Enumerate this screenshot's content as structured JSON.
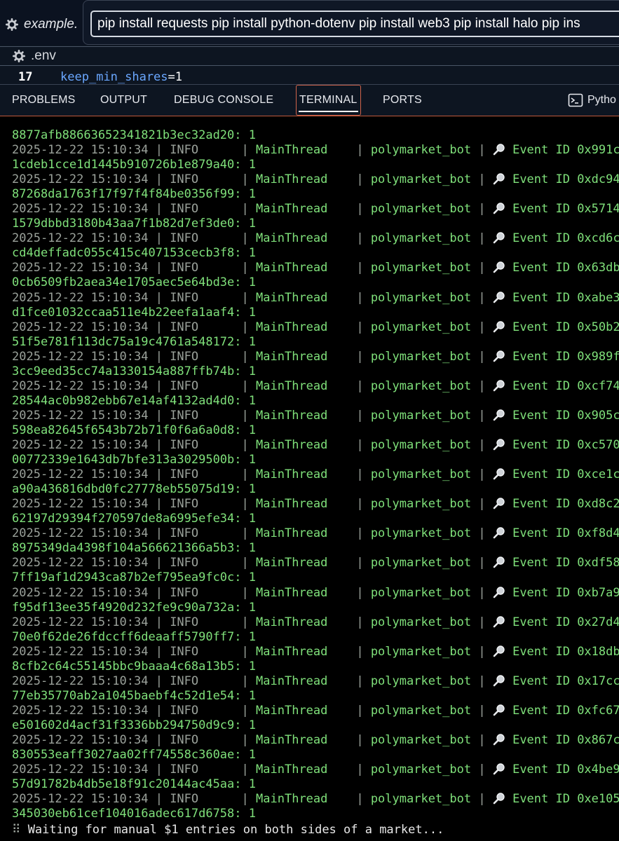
{
  "editor": {
    "tab_label": "example.",
    "command_value": "pip install requests pip install python-dotenv pip install web3 pip install halo pip ins",
    "env_file": ".env",
    "line_number": "17",
    "code_key": "keep_min_shares",
    "code_eq": "=",
    "code_value": "1"
  },
  "panel": {
    "tabs": [
      {
        "label": "PROBLEMS"
      },
      {
        "label": "OUTPUT"
      },
      {
        "label": "DEBUG CONSOLE"
      },
      {
        "label": "TERMINAL"
      },
      {
        "label": "PORTS"
      }
    ],
    "active_tab": "TERMINAL",
    "python_label": "Pytho"
  },
  "terminal": {
    "first_line": "8877afb88663652341821b3ec32ad20: 1",
    "timestamp": "2025-12-22 15:10:34",
    "level": "INFO",
    "thread": "MainThread",
    "logger": "polymarket_bot",
    "entries": [
      {
        "event": "Event ID 0x991c",
        "tail": "1cdeb1cce1d1445b910726b1e879a40: 1"
      },
      {
        "event": "Event ID 0xdc94",
        "tail": "87268da1763f17f97f4f84be0356f99: 1"
      },
      {
        "event": "Event ID 0x5714",
        "tail": "1579dbbd3180b43aa7f1b82d7ef3de0: 1"
      },
      {
        "event": "Event ID 0xcd6c",
        "tail": "cd4deffadc055c415c407153cecb3f8: 1"
      },
      {
        "event": "Event ID 0x63db",
        "tail": "0cb6509fb2aea34e1705aec5e64bd3e: 1"
      },
      {
        "event": "Event ID 0xabe3",
        "tail": "d1fce01032ccaa511e4b22eefa1aaf4: 1"
      },
      {
        "event": "Event ID 0x50b2",
        "tail": "51f5e781f113dc75a19c4761a548172: 1"
      },
      {
        "event": "Event ID 0x989f",
        "tail": "3cc9eed35cc74a1330154a887ffb74b: 1"
      },
      {
        "event": "Event ID 0xcf74",
        "tail": "28544ac0b982ebb67e14af4132ad4d0: 1"
      },
      {
        "event": "Event ID 0x905c",
        "tail": "598ea82645f6543b72b71f0f6a6a0d8: 1"
      },
      {
        "event": "Event ID 0xc570",
        "tail": "00772339e1643db7bfe313a3029500b: 1"
      },
      {
        "event": "Event ID 0xce1c",
        "tail": "a90a436816dbd0fc27778eb55075d19: 1"
      },
      {
        "event": "Event ID 0xd8c2",
        "tail": "62197d29394f270597de8a6995efe34: 1"
      },
      {
        "event": "Event ID 0xf8d4",
        "tail": "8975349da4398f104a566621366a5b3: 1"
      },
      {
        "event": "Event ID 0xdf58",
        "tail": "7ff19af1d2943ca87b2ef795ea9fc0c: 1"
      },
      {
        "event": "Event ID 0xb7a9",
        "tail": "f95df13ee35f4920d232fe9c90a732a: 1"
      },
      {
        "event": "Event ID 0x27d4",
        "tail": "70e0f62de26fdccff6deaaff5790ff7: 1"
      },
      {
        "event": "Event ID 0x18db",
        "tail": "8cfb2c64c55145bbc9baaa4c68a13b5: 1"
      },
      {
        "event": "Event ID 0x17cc",
        "tail": "77eb35770ab2a1045baebf4c52d1e54: 1"
      },
      {
        "event": "Event ID 0xfc67",
        "tail": "e501602d4acf31f3336bb294750d9c9: 1"
      },
      {
        "event": "Event ID 0x867c",
        "tail": "830553eaff3027aa02ff74558c360ae: 1"
      },
      {
        "event": "Event ID 0x4be9",
        "tail": "57d91782b4db5e18f91c20144ac45aa: 1"
      },
      {
        "event": "Event ID 0xe105",
        "tail": "345030eb61cef104016adec617d6758: 1"
      }
    ],
    "status_text": "Waiting for manual $1 entries on both sides of a market..."
  }
}
